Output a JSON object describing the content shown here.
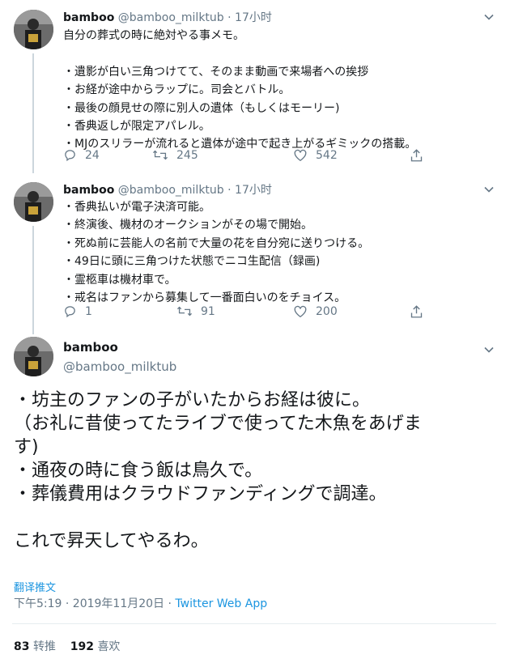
{
  "tweets": [
    {
      "name": "bamboo",
      "handle": "@bamboo_milktub",
      "dot": "·",
      "time": "17小时",
      "text": "自分の葬式の時に絶対やる事メモ。\n\n・遺影が白い三角つけてて、そのまま動画で来場者への挨拶\n・お経が途中からラップに。司会とバトル。\n・最後の顔見せの際に別人の遺体（もしくはモーリー)\n・香典返しが限定アパレル。\n・MJのスリラーが流れると遺体が途中で起き上がるギミックの搭載。",
      "replies": "24",
      "retweets": "245",
      "likes": "542"
    },
    {
      "name": "bamboo",
      "handle": "@bamboo_milktub",
      "dot": "·",
      "time": "17小时",
      "text": "・香典払いが電子決済可能。\n・終演後、機材のオークションがその場で開始。\n・死ぬ前に芸能人の名前で大量の花を自分宛に送りつける。\n・49日に頭に三角つけた状態でニコ生配信（録画)\n・霊柩車は機材車で。\n・戒名はファンから募集して一番面白いのをチョイス。",
      "replies": "1",
      "retweets": "91",
      "likes": "200"
    }
  ],
  "main_tweet": {
    "name": "bamboo",
    "handle": "@bamboo_milktub",
    "text": "・坊主のファンの子がいたからお経は彼に。\n（お礼に昔使ってたライブで使ってた木魚をあげま\nす)\n・通夜の時に食う飯は鳥久で。\n・葬儀費用はクラウドファンディングで調達。\n\nこれで昇天してやるわ。",
    "translate_label": "翻译推文",
    "timestamp": "下午5:19 · 2019年11月20日 · ",
    "source": "Twitter Web App",
    "retweet_count": "83",
    "retweet_label": "转推",
    "like_count": "192",
    "like_label": "喜欢"
  },
  "icons": {
    "reply": "reply-icon",
    "retweet": "retweet-icon",
    "like": "heart-icon",
    "share": "share-icon",
    "menu": "chevron-down-icon",
    "avatar": "avatar"
  },
  "colors": {
    "text": "#14171a",
    "secondary": "#657786",
    "link": "#1b95e0",
    "divider": "#e6ecf0",
    "thread_line": "#ccd6dd"
  }
}
